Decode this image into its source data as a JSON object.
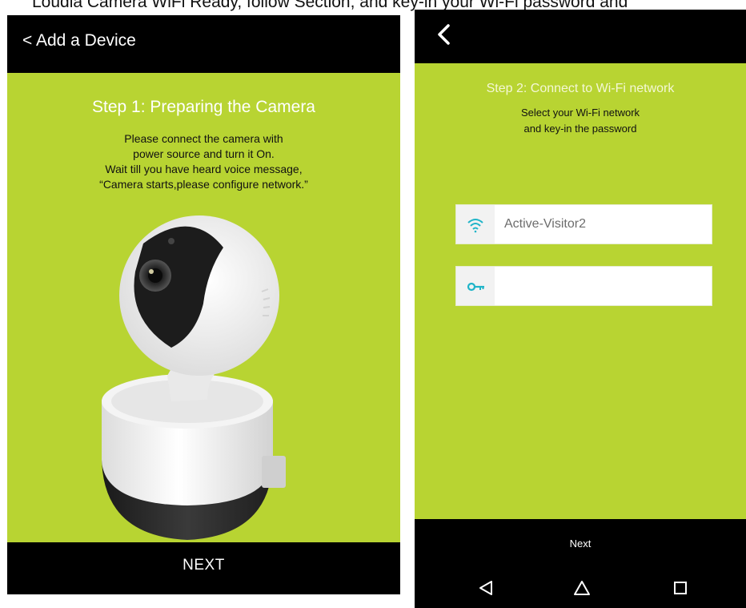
{
  "cutoff_text": "Loudia Camera WiFi Ready, follow Section, and key-in your Wi-Fi password and",
  "screen1": {
    "back_label": "< Add a Device",
    "title": "Step 1: Preparing the Camera",
    "instructions": [
      "Please connect the camera with",
      "power source and turn it On.",
      "Wait till you have heard voice message,",
      "“Camera starts,please configure network.”"
    ],
    "next_label": "NEXT"
  },
  "screen2": {
    "title": "Step 2: Connect to Wi-Fi network",
    "subtitle_lines": [
      "Select your Wi-Fi network",
      "and key-in the password"
    ],
    "wifi_field": {
      "value": "Active-Visitor2",
      "icon": "wifi-icon"
    },
    "password_field": {
      "value": "",
      "icon": "key-icon"
    },
    "next_label": "Next",
    "nav_icons": [
      "nav-back-icon",
      "nav-home-icon",
      "nav-recents-icon"
    ]
  },
  "colors": {
    "background_green": "#b8d432",
    "bar_black": "#000000",
    "icon_teal": "#1fb4c8"
  }
}
